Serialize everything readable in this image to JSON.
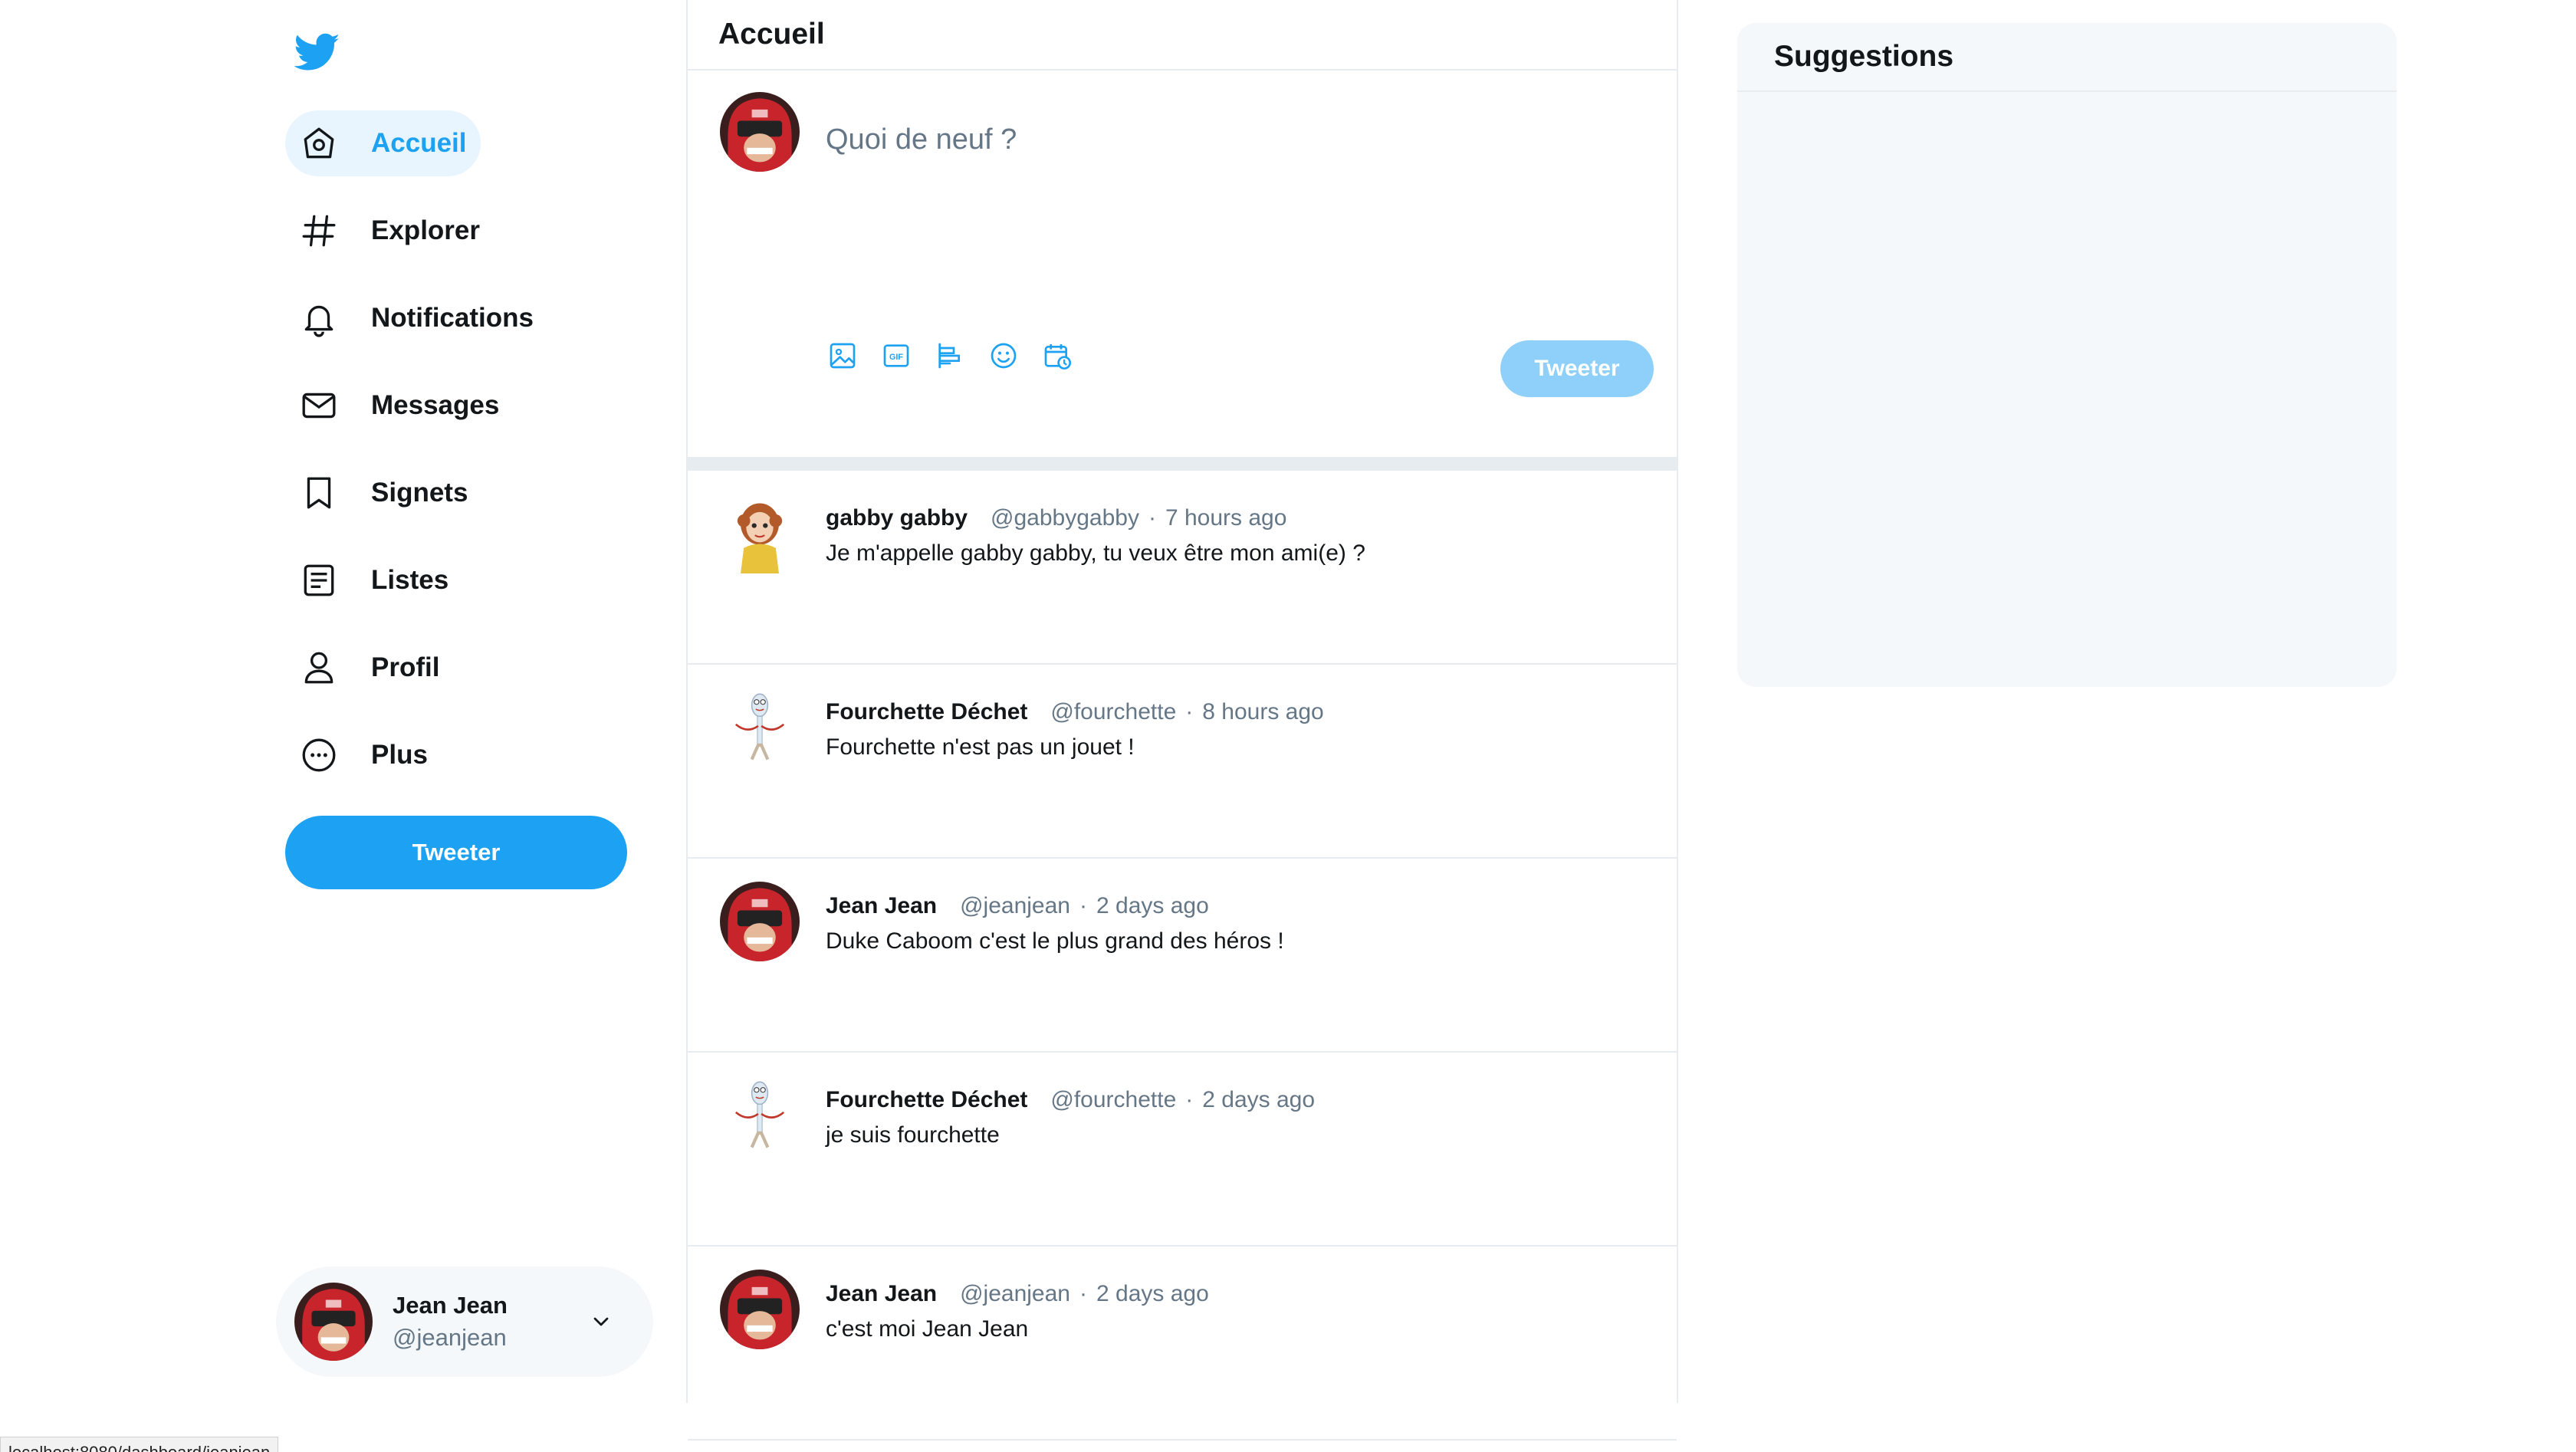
{
  "app": {
    "brand_color": "#1da1f2",
    "logo_icon": "bird-icon"
  },
  "nav": {
    "items": [
      {
        "label": "Accueil",
        "icon": "home-icon",
        "active": true
      },
      {
        "label": "Explorer",
        "icon": "hashtag-icon",
        "active": false
      },
      {
        "label": "Notifications",
        "icon": "bell-icon",
        "active": false
      },
      {
        "label": "Messages",
        "icon": "envelope-icon",
        "active": false
      },
      {
        "label": "Signets",
        "icon": "bookmark-icon",
        "active": false
      },
      {
        "label": "Listes",
        "icon": "list-icon",
        "active": false
      },
      {
        "label": "Profil",
        "icon": "person-icon",
        "active": false
      },
      {
        "label": "Plus",
        "icon": "more-circle-icon",
        "active": false
      }
    ],
    "tweet_button_label": "Tweeter"
  },
  "account": {
    "name": "Jean Jean",
    "handle": "@jeanjean"
  },
  "main": {
    "title": "Accueil",
    "composer": {
      "placeholder": "Quoi de neuf ?",
      "tools": [
        "image-icon",
        "gif-icon",
        "poll-icon",
        "emoji-icon",
        "schedule-icon"
      ],
      "tweet_button_label": "Tweeter"
    },
    "tweets": [
      {
        "name": "gabby gabby",
        "handle": "@gabbygabby",
        "time": "7 hours ago",
        "text": "Je m'appelle gabby gabby, tu veux être mon ami(e) ?",
        "avatar": "doll-avatar"
      },
      {
        "name": "Fourchette Déchet",
        "handle": "@fourchette",
        "time": "8 hours ago",
        "text": "Fourchette n'est pas un jouet !",
        "avatar": "fork-avatar"
      },
      {
        "name": "Jean Jean",
        "handle": "@jeanjean",
        "time": "2 days ago",
        "text": "Duke Caboom c'est le plus grand des héros !",
        "avatar": "helmet-avatar"
      },
      {
        "name": "Fourchette Déchet",
        "handle": "@fourchette",
        "time": "2 days ago",
        "text": "je suis fourchette",
        "avatar": "fork-avatar"
      },
      {
        "name": "Jean Jean",
        "handle": "@jeanjean",
        "time": "2 days ago",
        "text": "c'est moi Jean Jean",
        "avatar": "helmet-avatar"
      }
    ]
  },
  "sidebar_right": {
    "suggestions_title": "Suggestions"
  },
  "status_bar": {
    "url": "localhost:8080/dashboard/jeanjean"
  }
}
